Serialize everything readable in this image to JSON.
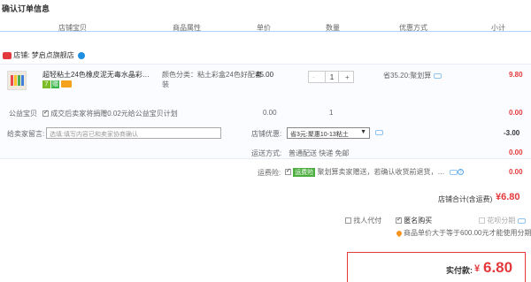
{
  "page_title": "确认订单信息",
  "header": {
    "col_item": "店铺宝贝",
    "col_attr": "商品属性",
    "col_price": "单价",
    "col_qty": "数量",
    "col_promo": "优惠方式",
    "col_subtotal": "小计"
  },
  "shop": {
    "label": "店铺:",
    "name": "梦启点旗舰店"
  },
  "item": {
    "title": "超轻粘土24色橡皮泥无毒水晶彩…",
    "attr_label": "颜色分类：",
    "attr_value": "粘土彩盒24色好配套装",
    "price": "45.00",
    "qty": "1",
    "minus": "-",
    "plus": "+",
    "promo": "省35.20:聚划算",
    "subtotal": "9.80",
    "badge_7": "7",
    "badge_s": "赠"
  },
  "charity": {
    "label": "公益宝贝",
    "text": "成交后卖家将捐赠0.02元给公益宝贝计划",
    "price": "0.00",
    "qty": "1",
    "subtotal": "0.00"
  },
  "message": {
    "label": "给卖家留言:",
    "placeholder": "选填:填写内容已和卖家协商确认"
  },
  "shop_discount": {
    "label": "店铺优惠:",
    "selected": "省3元:聚惠10-13粘土",
    "value": "-3.00"
  },
  "shipping": {
    "label": "运送方式:",
    "text": "普通配送 快递 免邮",
    "value": "0.00"
  },
  "insurance": {
    "label": "运费险:",
    "tag": "运费险",
    "text": "聚划算卖家赠送，若确认收货前退货，…",
    "value": "0.00"
  },
  "shop_total": {
    "label": "店铺合计(含运费)",
    "value": "¥6.80"
  },
  "options": {
    "proxy_label": "找人代付",
    "anon_label": "匿名购买",
    "installment_label": "花呗分期",
    "notice": "商品单价大于等于600.00元才能使用分期"
  },
  "payment": {
    "label": "实付款:",
    "currency": "¥",
    "value": "6.80"
  },
  "colors": {
    "accent_red": "#e4393c",
    "link_blue": "#1e8fe1",
    "header_border": "#b2d1ff"
  }
}
